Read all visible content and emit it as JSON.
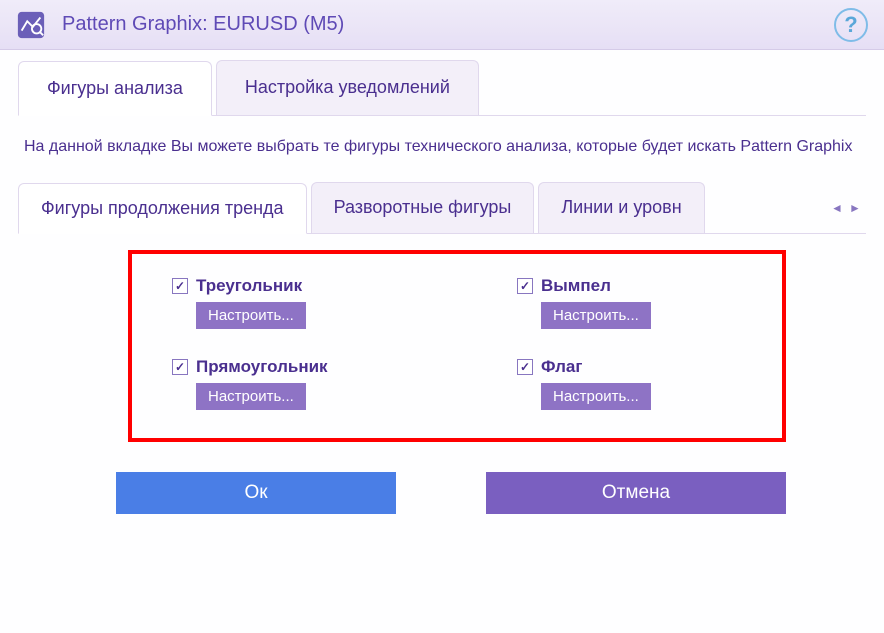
{
  "title": "Pattern Graphix: EURUSD (M5)",
  "tabs": {
    "analysis": "Фигуры анализа",
    "notifications": "Настройка уведомлений"
  },
  "description": "На данной вкладке Вы можете выбрать те фигуры технического анализа, которые будет искать Pattern Graphix",
  "subtabs": {
    "continuation": "Фигуры продолжения тренда",
    "reversal": "Разворотные фигуры",
    "lines": "Линии и уровн"
  },
  "patterns": {
    "triangle": "Треугольник",
    "pennant": "Вымпел",
    "rectangle": "Прямоугольник",
    "flag": "Флаг"
  },
  "configure_label": "Настроить...",
  "buttons": {
    "ok": "Ок",
    "cancel": "Отмена"
  },
  "checkmark": "✓",
  "help_glyph": "?"
}
